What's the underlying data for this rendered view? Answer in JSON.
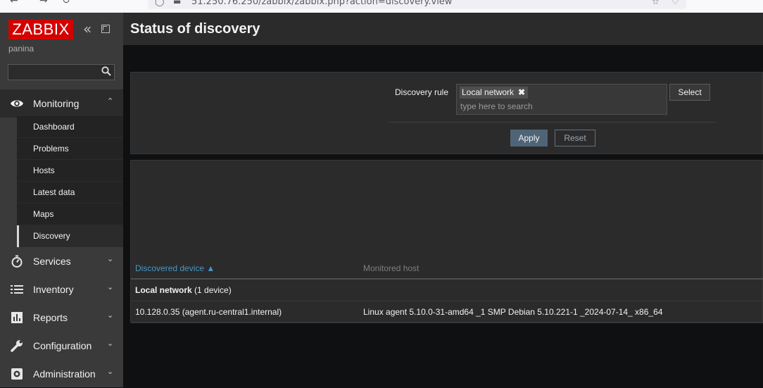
{
  "browser": {
    "back_glyph": "←",
    "forward_glyph": "→",
    "reload_glyph": "↻",
    "url": "51.250.76.250/zabbix/zabbix.php?action=discovery.view"
  },
  "sidebar": {
    "logo": "ZABBIX",
    "username": "panina",
    "search": {
      "value": "",
      "placeholder": ""
    },
    "sections": [
      {
        "label": "Monitoring",
        "icon": "eye-icon",
        "expanded": true
      },
      {
        "label": "Services",
        "icon": "stopwatch-icon"
      },
      {
        "label": "Inventory",
        "icon": "list-icon"
      },
      {
        "label": "Reports",
        "icon": "bar-chart-icon"
      },
      {
        "label": "Configuration",
        "icon": "wrench-icon"
      },
      {
        "label": "Administration",
        "icon": "gear-icon"
      }
    ],
    "monitoring_items": [
      {
        "label": "Dashboard"
      },
      {
        "label": "Problems"
      },
      {
        "label": "Hosts"
      },
      {
        "label": "Latest data"
      },
      {
        "label": "Maps"
      },
      {
        "label": "Discovery",
        "active": true
      }
    ]
  },
  "header": {
    "title": "Status of discovery"
  },
  "filter": {
    "discovery_rule_label": "Discovery rule",
    "selected_tag": "Local network",
    "input_placeholder": "type here to search",
    "select_label": "Select",
    "apply_label": "Apply",
    "reset_label": "Reset"
  },
  "table": {
    "columns": [
      "Discovered device ▲",
      "Monitored host"
    ],
    "group": {
      "name": "Local network",
      "count_text": "(1 device)"
    },
    "rows": [
      {
        "device": "10.128.0.35 (agent.ru-central1.internal)",
        "host": "Linux agent 5.10.0-31-amd64 _1 SMP Debian 5.10.221-1 _2024-07-14_ x86_64"
      }
    ]
  },
  "colors": {
    "accent": "#4796c4",
    "logo": "#d40000",
    "apply": "#4f6477"
  }
}
